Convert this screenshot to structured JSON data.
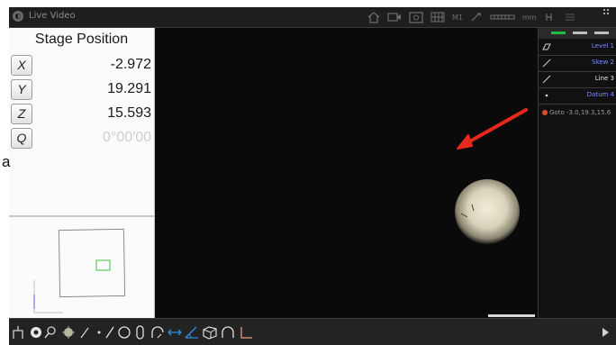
{
  "window": {
    "title": "Live Video"
  },
  "titlebar": {
    "icons": [
      "home-icon",
      "camera-icon",
      "zoom-frame-icon",
      "grid-icon",
      "light-icon",
      "scale-icon"
    ],
    "labels": {
      "magnification": "M1",
      "units": "mm"
    }
  },
  "stage": {
    "title": "Stage Position",
    "axes": [
      {
        "label": "X",
        "value": "-2.972"
      },
      {
        "label": "Y",
        "value": "19.291"
      },
      {
        "label": "Z",
        "value": "15.593"
      },
      {
        "label": "Q",
        "value": "0°00'00"
      }
    ]
  },
  "features": [
    {
      "icon": "plane-icon",
      "label": "Level 1"
    },
    {
      "icon": "line-icon",
      "label": "Skew 2"
    },
    {
      "icon": "line-icon",
      "label": "Line 3"
    },
    {
      "icon": "point-icon",
      "label": "Datum 4"
    }
  ],
  "goto": {
    "label": "Goto -3.0,19.3,15.6"
  },
  "toolbar": {
    "tools": [
      "probe-icon",
      "target-icon",
      "magnifier-icon",
      "light-icon",
      "edge-tool-icon",
      "point-icon",
      "line-icon",
      "circle-icon",
      "slot-icon",
      "arc-icon",
      "distance-icon",
      "angle-icon",
      "cylinder-icon",
      "curve-icon",
      "datum-icon"
    ]
  },
  "stray_text": "a",
  "colors": {
    "accent": "#7d8cff",
    "arrow": "#e8281e",
    "goto_dot": "#e04a2a",
    "toolbar_active": "#2f8fe0"
  }
}
